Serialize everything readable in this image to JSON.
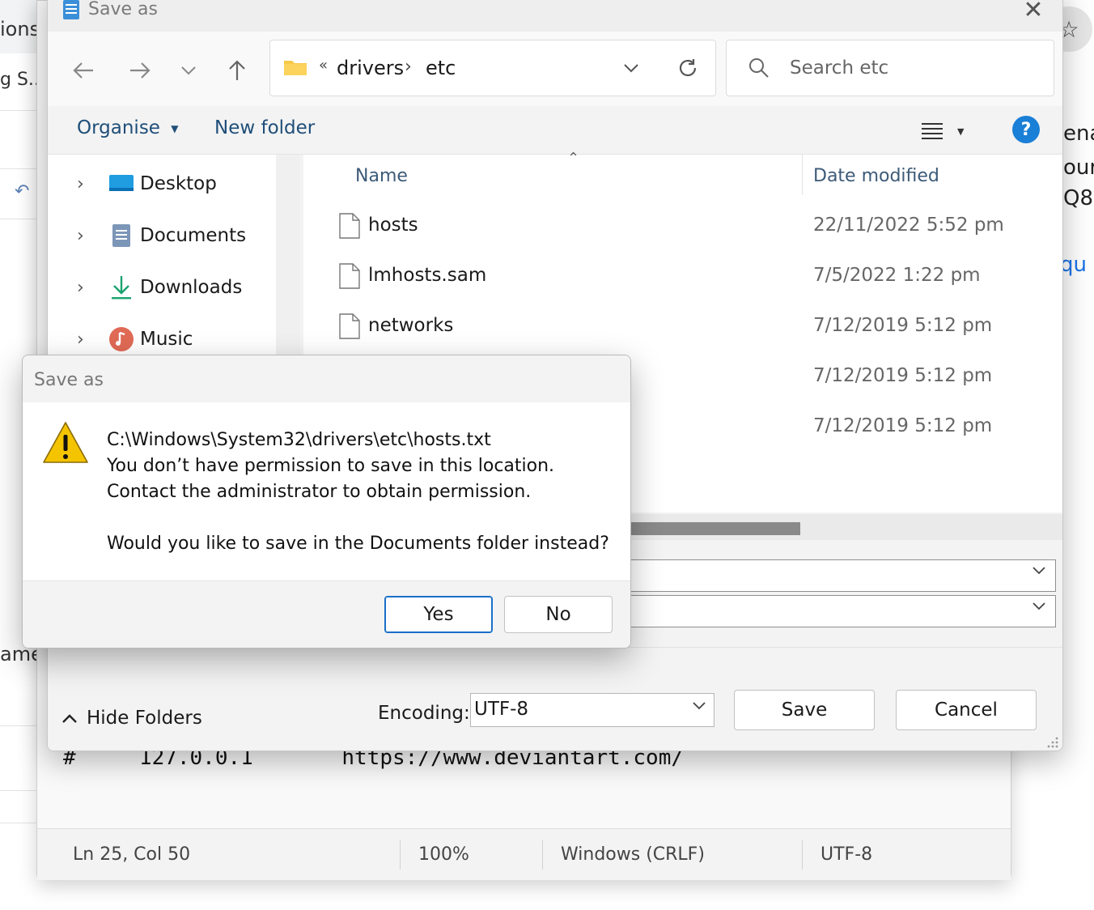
{
  "background": {
    "left_fragments": [
      "ions",
      "g S...",
      "ame"
    ],
    "right_fragments": [
      "ena",
      "our",
      "Q8"
    ],
    "right_link": "qu"
  },
  "notepad": {
    "code_line": "#     127.0.0.1       https://www.deviantart.com/",
    "status": {
      "position": "Ln 25, Col 50",
      "zoom": "100%",
      "line_ending": "Windows (CRLF)",
      "encoding": "UTF-8"
    }
  },
  "saveas": {
    "title": "Save as",
    "address": {
      "overflow": "«",
      "crumbs": [
        "drivers",
        "etc"
      ]
    },
    "search_placeholder": "Search etc",
    "toolbar": {
      "organise": "Organise",
      "new_folder": "New folder"
    },
    "nav_items": [
      {
        "label": "Desktop",
        "icon": "desktop-icon"
      },
      {
        "label": "Documents",
        "icon": "documents-icon"
      },
      {
        "label": "Downloads",
        "icon": "downloads-icon"
      },
      {
        "label": "Music",
        "icon": "music-icon"
      }
    ],
    "columns": {
      "name": "Name",
      "date": "Date modified"
    },
    "files": [
      {
        "name": "hosts",
        "date": "22/11/2022 5:52 pm"
      },
      {
        "name": "lmhosts.sam",
        "date": "7/5/2022 1:22 pm"
      },
      {
        "name": "networks",
        "date": "7/12/2019 5:12 pm"
      },
      {
        "name": "",
        "date": "7/12/2019 5:12 pm"
      },
      {
        "name": "",
        "date": "7/12/2019 5:12 pm"
      }
    ],
    "hide_folders": "Hide Folders",
    "encoding_label": "Encoding:",
    "encoding_value": "UTF-8",
    "save": "Save",
    "cancel": "Cancel"
  },
  "message_box": {
    "title": "Save as",
    "lines": [
      "C:\\Windows\\System32\\drivers\\etc\\hosts.txt",
      "You don’t have permission to save in this location.",
      "Contact the administrator to obtain permission.",
      "Would you like to save in the Documents folder instead?"
    ],
    "yes": "Yes",
    "no": "No"
  },
  "colors": {
    "accent": "#1a6fc9",
    "help": "#1a7fd6",
    "warning": "#f5c400"
  }
}
